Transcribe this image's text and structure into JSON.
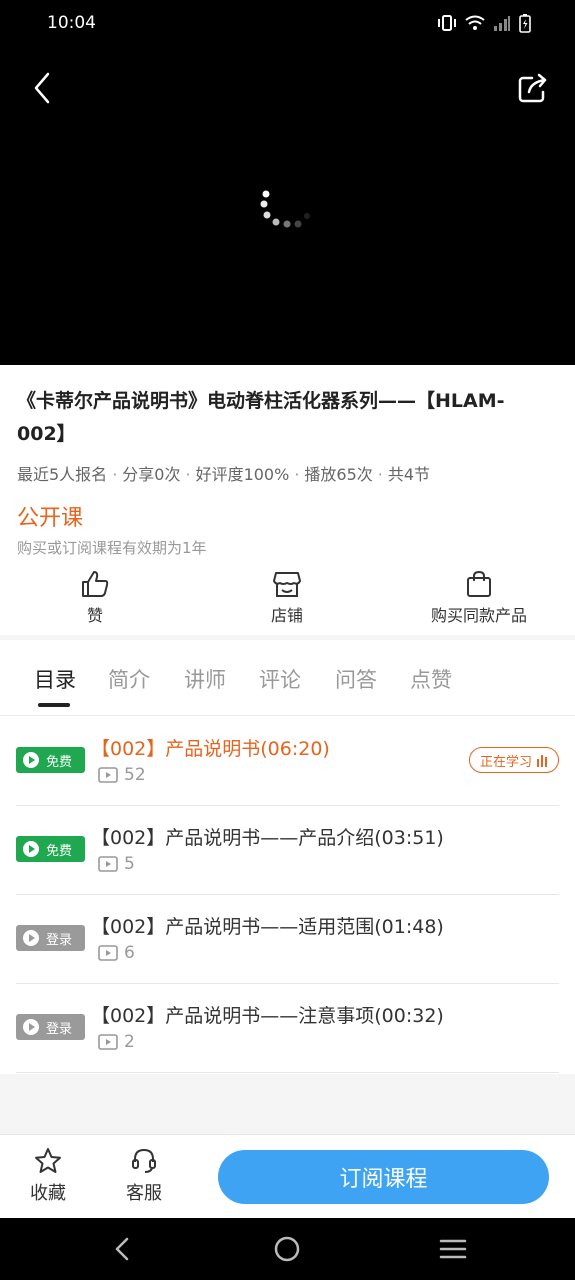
{
  "status_bar": {
    "time": "10:04",
    "icons": [
      "vibrate-icon",
      "wifi-icon",
      "signal-icon",
      "battery-charging-icon"
    ]
  },
  "player": {
    "back_icon": "chevron-left-icon",
    "share_icon": "share-icon",
    "loading_icon": "spinner-icon"
  },
  "course": {
    "title": "《卡蒂尔产品说明书》电动脊柱活化器系列——【HLAM-002】",
    "stats": [
      "最近5人报名",
      "分享0次",
      "好评度100%",
      "播放65次",
      "共4节"
    ],
    "stats_separator": "·",
    "type": "公开课",
    "validity": "购买或订阅课程有效期为1年"
  },
  "actions": [
    {
      "label": "赞",
      "icon": "thumb-up-icon"
    },
    {
      "label": "店铺",
      "icon": "shop-icon"
    },
    {
      "label": "购买同款产品",
      "icon": "shopping-bag-icon"
    }
  ],
  "tabs": [
    {
      "label": "目录",
      "active": true
    },
    {
      "label": "简介"
    },
    {
      "label": "讲师"
    },
    {
      "label": "评论"
    },
    {
      "label": "问答"
    },
    {
      "label": "点赞"
    }
  ],
  "lessons": [
    {
      "badge": "免费",
      "badge_type": "free",
      "title": "【002】产品说明书(06:20)",
      "plays": "52",
      "current": true,
      "status": "正在学习"
    },
    {
      "badge": "免费",
      "badge_type": "free",
      "title": "【002】产品说明书——产品介绍(03:51)",
      "plays": "5"
    },
    {
      "badge": "登录",
      "badge_type": "login",
      "title": "【002】产品说明书——适用范围(01:48)",
      "plays": "6"
    },
    {
      "badge": "登录",
      "badge_type": "login",
      "title": "【002】产品说明书——注意事项(00:32)",
      "plays": "2"
    }
  ],
  "bottom_bar": {
    "favorite": {
      "label": "收藏",
      "icon": "star-icon"
    },
    "service": {
      "label": "客服",
      "icon": "headset-icon"
    },
    "subscribe": "订阅课程"
  },
  "colors": {
    "accent_orange": "#e8641c",
    "free_green": "#1fa84f",
    "login_gray": "#9a9a9a",
    "subscribe_blue": "#3ea3f3"
  }
}
